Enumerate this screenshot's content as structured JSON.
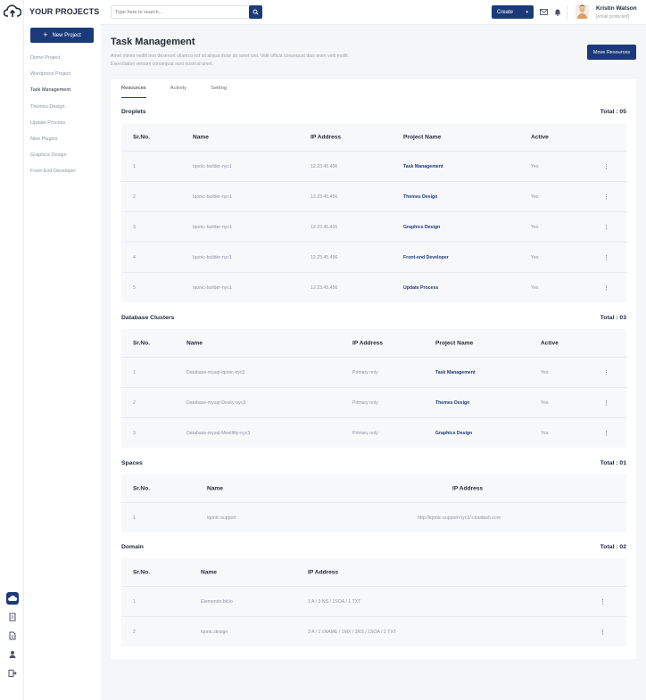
{
  "brand": {
    "name": "YOUR PROJECTS"
  },
  "sidebar": {
    "new_project_label": "New Project",
    "items": [
      {
        "label": "Demo Project"
      },
      {
        "label": "Wordpress Project"
      },
      {
        "label": "Task Management"
      },
      {
        "label": "Themes Design"
      },
      {
        "label": "Update Process"
      },
      {
        "label": "New Plugins"
      },
      {
        "label": "Graphics Design"
      },
      {
        "label": "Front-End Developer"
      }
    ]
  },
  "topbar": {
    "search_placeholder": "Type here to search...",
    "create_label": "Create",
    "user_name": "Kristin Watson",
    "user_email": "[email protected]"
  },
  "page": {
    "title": "Task Management",
    "description": "Amet minim mollit non deserunt ullamco est sit aliqua dolor do amet sint. Velit officia consequat duis enim velit mollit. Exercitation veniam consequat sunt nostrud amet.",
    "move_label": "Move Resources"
  },
  "tabs": [
    "Resources",
    "Activity",
    "Setting"
  ],
  "droplets": {
    "title": "Droplets",
    "total": "Total : 05",
    "headers": [
      "Sr.No.",
      "Name",
      "IP Address",
      "Project Name",
      "Active"
    ],
    "rows": [
      {
        "no": "1",
        "name": "Iqonic-builder-nyc1",
        "ip": "12.23.45.456",
        "project": "Task Management",
        "active": "Yes"
      },
      {
        "no": "2",
        "name": "Iqonic-builder-nyc1",
        "ip": "12.23.45.456",
        "project": "Themes Design",
        "active": "Yes"
      },
      {
        "no": "3",
        "name": "Iqonic-builder-nyc1",
        "ip": "12.23.45.456",
        "project": "Graphics Design",
        "active": "Yes"
      },
      {
        "no": "4",
        "name": "Iqonic-builder-nyc1",
        "ip": "12.23.45.456",
        "project": "Front-end Developer",
        "active": "Yes"
      },
      {
        "no": "5",
        "name": "Iqonic-builder-nyc1",
        "ip": "12.23.45.456",
        "project": "Update Process",
        "active": "Yes"
      }
    ]
  },
  "database": {
    "title": "Database Clusters",
    "total": "Total : 03",
    "headers": [
      "Sr.No.",
      "Name",
      "IP Address",
      "Project Name",
      "Active"
    ],
    "rows": [
      {
        "no": "1",
        "name": "Database-mysql-iqonic-nyc3",
        "ip": "Primary only",
        "project": "Task Management",
        "active": "Yes"
      },
      {
        "no": "2",
        "name": "Database-mysql-Desky-nyc3",
        "ip": "Primary only",
        "project": "Themes Design",
        "active": "Yes"
      },
      {
        "no": "3",
        "name": "Database-mysql-Meetlitty-nyc3",
        "ip": "Primary only",
        "project": "Graphics Design",
        "active": "Yes"
      }
    ]
  },
  "spaces": {
    "title": "Spaces",
    "total": "Total : 01",
    "headers": [
      "Sr.No.",
      "Name",
      "IP Address"
    ],
    "rows": [
      {
        "no": "1",
        "name": "iqonic-support",
        "ip": "http://iqonic-support-nyc3/.cloudash.com"
      }
    ]
  },
  "domain": {
    "title": "Domain",
    "total": "Total : 02",
    "headers": [
      "Sr.No.",
      "Name",
      "IP Address"
    ],
    "rows": [
      {
        "no": "1",
        "name": "Elementor.bit.io",
        "ip": "1 A / 3 NS / 1SOA / 1 TXT"
      },
      {
        "no": "2",
        "name": "iqonic.design",
        "ip": "3 A / 1 cNAME / 1MX / 3NS / 1SOA / 2 TXT"
      }
    ]
  },
  "icons": {
    "logo": "cloud-upload-icon",
    "search": "search-icon",
    "mail": "mail-icon",
    "bell": "bell-icon",
    "kebab": "more-vertical-icon",
    "rail": [
      "cloud-icon",
      "clipboard-icon",
      "document-icon",
      "user-icon",
      "exit-icon"
    ]
  },
  "colors": {
    "accent": "#1b3a7a",
    "background": "#f5f6f8",
    "muted": "#8a93a3"
  }
}
